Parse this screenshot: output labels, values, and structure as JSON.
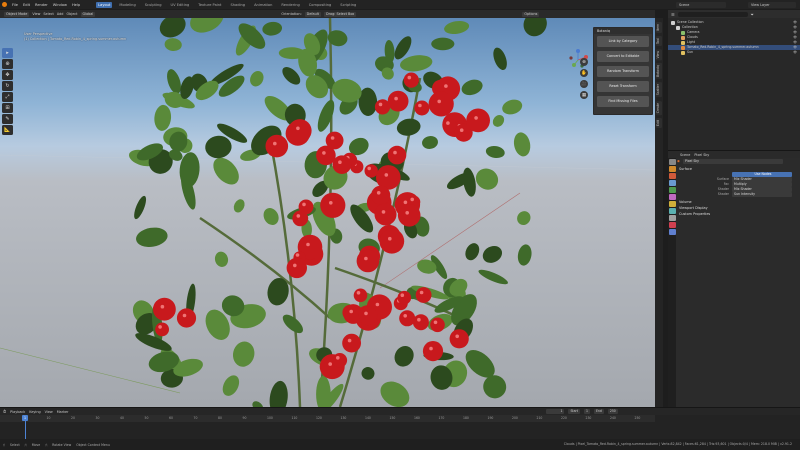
{
  "topbar": {
    "menus": [
      "File",
      "Edit",
      "Render",
      "Window",
      "Help"
    ],
    "workspaces": [
      "Layout",
      "Modeling",
      "Sculpting",
      "UV Editing",
      "Texture Paint",
      "Shading",
      "Animation",
      "Rendering",
      "Compositing",
      "Scripting"
    ],
    "active_workspace": "Layout",
    "scene": "Scene",
    "view_layer": "View Layer"
  },
  "viewport_header": {
    "mode": "Object Mode",
    "view": "View",
    "select": "Select",
    "add": "Add",
    "object": "Object",
    "pivot": "Global",
    "orientation_label": "Orientation:",
    "orientation_value": "Default",
    "snap": "Drag: Select Box",
    "overlays": "Options"
  },
  "viewport": {
    "info_line1": "User Perspective",
    "info_line2": "(1) Collection | Tomato_Red.Robin_4_spring.summer.autumn",
    "sky_top": "#5f8ab8",
    "ground": "#a4a8ae",
    "leaf_color": "#3f6a2a",
    "tomato_color": "#c8191d"
  },
  "addon_panel": {
    "title": "Botaniq",
    "buttons": [
      "Link by Category",
      "Convert to Editable",
      "Random Transform",
      "Reset Transform",
      "Find Missing Files"
    ]
  },
  "n_tabs": [
    "Item",
    "Tool",
    "View",
    "Botaniq",
    "Scatter",
    "Create",
    "Edit"
  ],
  "outliner": {
    "search_placeholder": "",
    "items": [
      {
        "label": "Scene Collection",
        "indent": 0,
        "icon_color": "#cfcfcf",
        "selected": false
      },
      {
        "label": "Collection",
        "indent": 1,
        "icon_color": "#cfcfcf",
        "selected": false
      },
      {
        "label": "Camera",
        "indent": 2,
        "icon_color": "#8ac06b",
        "selected": false
      },
      {
        "label": "Clouds",
        "indent": 2,
        "icon_color": "#e0a060",
        "selected": false
      },
      {
        "label": "Light",
        "indent": 2,
        "icon_color": "#e0c060",
        "selected": false
      },
      {
        "label": "Tomato_Red.Robin_4_spring.summer.autumn",
        "indent": 2,
        "icon_color": "#e08a40",
        "selected": true
      },
      {
        "label": "Sun",
        "indent": 2,
        "icon_color": "#e0c060",
        "selected": false
      }
    ]
  },
  "properties": {
    "header_world": "Scene",
    "header_sky": "Pixel Sky",
    "world_name": "Pixel Sky",
    "sections": {
      "surface": "Surface",
      "volume": "Volume",
      "viewport_display": "Viewport Display",
      "custom_properties": "Custom Properties"
    },
    "use_nodes": "Use Nodes",
    "fields": [
      {
        "label": "Surface",
        "value": "Mix Shader"
      },
      {
        "label": "Fac",
        "value": "Multiply"
      },
      {
        "label": "Shader",
        "value": "Mix Shader"
      },
      {
        "label": "Shader",
        "value": "Sun Intensity"
      }
    ],
    "tab_colors": [
      "#888",
      "#d0892b",
      "#d05a3a",
      "#6a9ad0",
      "#4f9a4f",
      "#c06ac0",
      "#d0b03a",
      "#5ab0b0",
      "#a0a0a0",
      "#d04050",
      "#6080d0"
    ]
  },
  "timeline": {
    "menus": [
      "Playback",
      "Keying",
      "View",
      "Marker"
    ],
    "current_frame": "1",
    "start_label": "Start",
    "start": "1",
    "end_label": "End",
    "end": "250",
    "ticks": [
      "0",
      "10",
      "20",
      "30",
      "40",
      "50",
      "60",
      "70",
      "80",
      "90",
      "100",
      "110",
      "120",
      "130",
      "140",
      "150",
      "160",
      "170",
      "180",
      "190",
      "200",
      "210",
      "220",
      "230",
      "240",
      "250"
    ]
  },
  "status": {
    "select": "Select",
    "move": "Move",
    "rotate_view": "Rotate View",
    "context_menu": "Object Context Menu",
    "stats": "Clouds | Pixel_Tomato_Red.Robin_4_spring.summer.autumn | Verts:82,842 | Faces:61,284 | Tris:93,601 | Objects:0/4 | Mem: 218.0 MiB | v2.91.2"
  }
}
